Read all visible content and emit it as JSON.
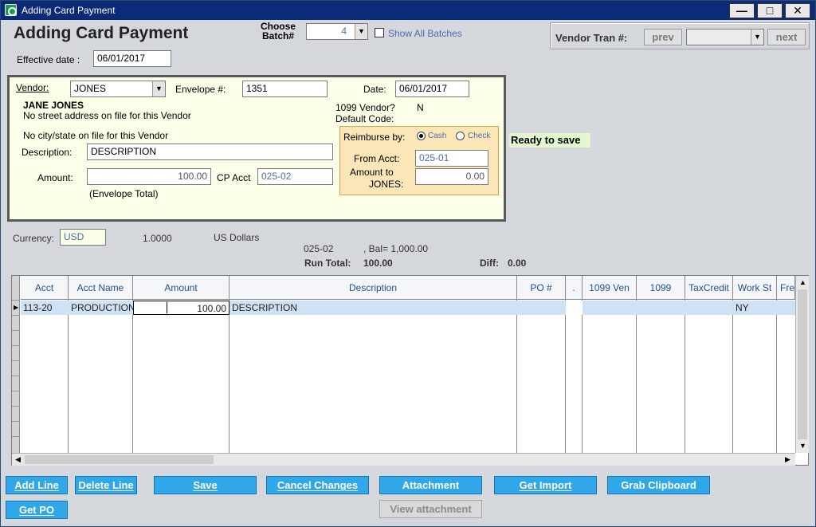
{
  "window": {
    "title": "Adding Card Payment"
  },
  "heading": "Adding Card Payment",
  "batch": {
    "label": "Choose Batch#",
    "value": "4",
    "show_all_label": "Show All Batches"
  },
  "vendor_tran": {
    "label": "Vendor Tran #:",
    "prev": "prev",
    "next": "next",
    "value": ""
  },
  "effective_date": {
    "label": "Effective date :",
    "value": "06/01/2017"
  },
  "vendor": {
    "label": "Vendor:",
    "value": "JONES",
    "envelope_label": "Envelope #:",
    "envelope_value": "1351",
    "date_label": "Date:",
    "date_value": "06/01/2017",
    "name": "JANE JONES",
    "street_note": "No street address on file for this Vendor",
    "city_note": "No city/state on file for this Vendor",
    "v1099_label": "1099 Vendor?",
    "v1099_value": "N",
    "default_code_label": "Default Code:",
    "description_label": "Description:",
    "description_value": "DESCRIPTION",
    "amount_label": "Amount:",
    "amount_value": "100.00",
    "cp_acct_label": "CP Acct",
    "cp_acct_value": "025-02",
    "envelope_total": "(Envelope Total)"
  },
  "reimburse": {
    "label": "Reimburse by:",
    "cash": "Cash",
    "check": "Check",
    "selected": "Cash",
    "from_acct_label": "From Acct:",
    "from_acct_value": "025-01",
    "amount_to_label_1": "Amount to",
    "amount_to_label_2": "JONES:",
    "amount_value": "0.00"
  },
  "status": "Ready to save",
  "currency": {
    "label": "Currency:",
    "value": "USD",
    "rate": "1.0000",
    "name": "US Dollars"
  },
  "balance": {
    "acct": "025-02",
    "bal": ",  Bal= 1,000.00"
  },
  "totals": {
    "run_total_label": "Run Total:",
    "run_total_value": "100.00",
    "diff_label": "Diff:",
    "diff_value": "0.00"
  },
  "grid": {
    "columns": [
      "Acct",
      "Acct Name",
      "Amount",
      "Description",
      "PO #",
      ".",
      "1099 Ven",
      "1099",
      "TaxCredit",
      "Work St",
      "Fre"
    ],
    "rows": [
      {
        "acct": "113-20",
        "acct_name": "PRODUCTION",
        "amount": "100.00",
        "description": "DESCRIPTION",
        "po": "",
        "dot": "",
        "ven1099": "",
        "v1099": "",
        "taxcredit": "",
        "work_st": "NY",
        "fre": ""
      }
    ]
  },
  "buttons": {
    "add_line": "Add Line",
    "delete_line": "Delete Line",
    "save": "Save",
    "cancel_changes": "Cancel Changes",
    "attachment": "Attachment",
    "get_import": "Get Import",
    "grab_clipboard": "Grab Clipboard",
    "get_po": "Get PO",
    "view_attachment": "View attachment"
  },
  "colors": {
    "title_bar": "#0b2a78",
    "button": "#30a7e8",
    "vendor_panel": "#fbffe7",
    "reimburse_panel": "#fbe6b8",
    "ready_bg": "#e3f7cf"
  }
}
